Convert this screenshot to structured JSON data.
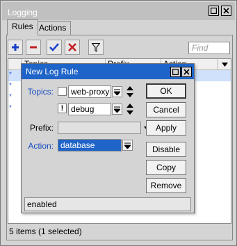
{
  "window": {
    "title": "Logging",
    "tabs": [
      "Rules",
      "Actions"
    ],
    "find_placeholder": "Find",
    "table_columns": [
      "Topics",
      "Prefix",
      "Action"
    ],
    "row_count": 5,
    "status": "5 items (1 selected)"
  },
  "dialog": {
    "title": "New Log Rule",
    "topics_label": "Topics:",
    "topic1": "web-proxy",
    "topic2_flag": "!",
    "topic2": "debug",
    "prefix_label": "Prefix:",
    "prefix_value": "",
    "action_label": "Action:",
    "action_value": "database",
    "buttons": [
      "OK",
      "Cancel",
      "Apply",
      "Disable",
      "Copy",
      "Remove"
    ],
    "status": "enabled"
  },
  "colors": {
    "title_bar": "#1f64c8",
    "label_blue": "#1a4fc0",
    "add_icon": "#1a3fc9",
    "remove_icon": "#c41f1f"
  }
}
